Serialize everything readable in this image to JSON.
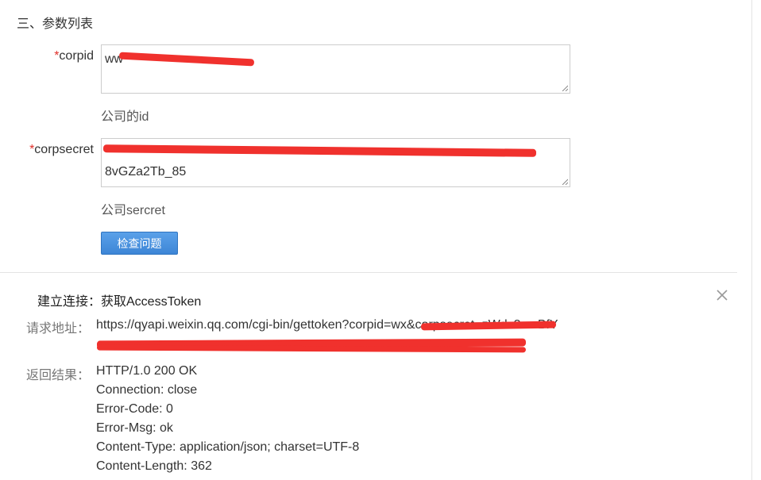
{
  "section": {
    "title": "三、参数列表"
  },
  "params": [
    {
      "required_mark": "*",
      "label": "corpid",
      "value": "ww",
      "hint": "公司的id"
    },
    {
      "required_mark": "*",
      "label": "corpsecret",
      "value_line2": "8vGZa2Tb_85",
      "hint": "公司sercret"
    }
  ],
  "check_button": {
    "label": "检查问题"
  },
  "result": {
    "title": "建立连接：获取AccessToken",
    "request_label": "请求地址：",
    "request_url_line1": "https://qyapi.weixin.qq.com/cgi-bin/gettoken?corpid=wx&corpsecret=zWdc3sc-BfY",
    "response_label": "返回结果：",
    "response_lines": [
      "HTTP/1.0 200 OK",
      "Connection: close",
      "Error-Code: 0",
      "Error-Msg: ok",
      "Content-Type: application/json; charset=UTF-8",
      "Content-Length: 362"
    ]
  },
  "colors": {
    "required": "#e0302a",
    "button": "#3d86d6",
    "redaction": "#f0312d"
  },
  "icons": {
    "close": "close-icon",
    "resize": "resize-grip-icon"
  }
}
